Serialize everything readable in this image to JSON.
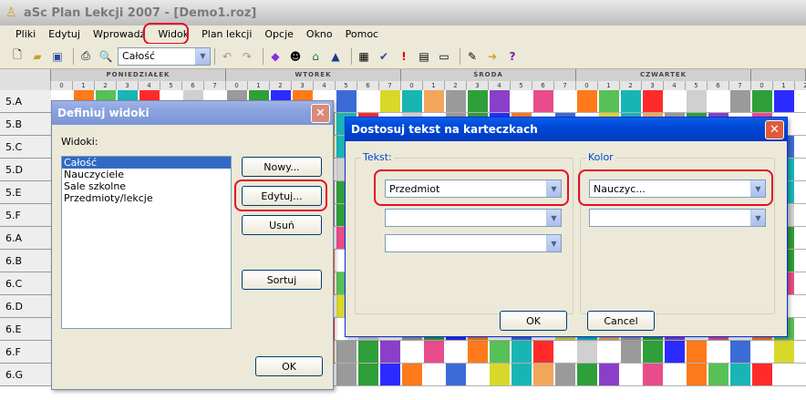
{
  "window": {
    "title": "aSc Plan Lekcji 2007  - [Demo1.roz]"
  },
  "menu": [
    "Pliki",
    "Edytuj",
    "Wprowadź",
    "Widok",
    "Plan lekcji",
    "Opcje",
    "Okno",
    "Pomoc"
  ],
  "toolbar": {
    "view_combo": "Całość"
  },
  "grid": {
    "days": [
      "PONIEDZIAŁEK",
      "WTOREK",
      "ŚRODA",
      "CZWARTEK"
    ],
    "hours": [
      "0",
      "1",
      "2",
      "3",
      "4",
      "5",
      "6",
      "7"
    ],
    "rows": [
      "5.A",
      "5.B",
      "5.C",
      "5.D",
      "5.E",
      "5.F",
      "6.A",
      "6.B",
      "6.C",
      "6.D",
      "6.E",
      "6.F",
      "6.G"
    ]
  },
  "dialog_views": {
    "title": "Definiuj widoki",
    "list_label": "Widoki:",
    "items": [
      "Całość",
      "Nauczyciele",
      "Sale szkolne",
      "Przedmioty/lekcje"
    ],
    "new_button": "Nowy...",
    "edit_button": "Edytuj...",
    "delete_button": "Usuń",
    "sort_button": "Sortuj",
    "ok_button": "OK"
  },
  "dialog_text": {
    "title": "Dostosuj tekst na karteczkach",
    "text_group": "Tekst:",
    "color_group": "Kolor",
    "text_combo1": "Przedmiot",
    "text_combo2": "",
    "text_combo3": "",
    "color_combo1": "Nauczyc...",
    "color_combo2": "",
    "ok_button": "OK",
    "cancel_button": "Cancel"
  }
}
